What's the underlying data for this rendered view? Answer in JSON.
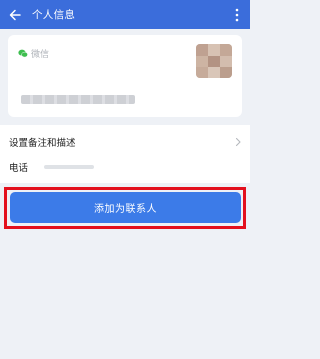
{
  "header": {
    "title": "个人信息",
    "back_icon": "arrow-left-icon",
    "more_icon": "more-vertical-icon",
    "color": "#3b6ddb"
  },
  "profile": {
    "source_label": "微信",
    "source_icon": "wechat-icon"
  },
  "rows": {
    "remark_label": "设置备注和描述",
    "phone_label": "电话"
  },
  "actions": {
    "add_contact_label": "添加为联系人",
    "button_color": "#3c7be8",
    "highlight_color": "#e3101d"
  }
}
